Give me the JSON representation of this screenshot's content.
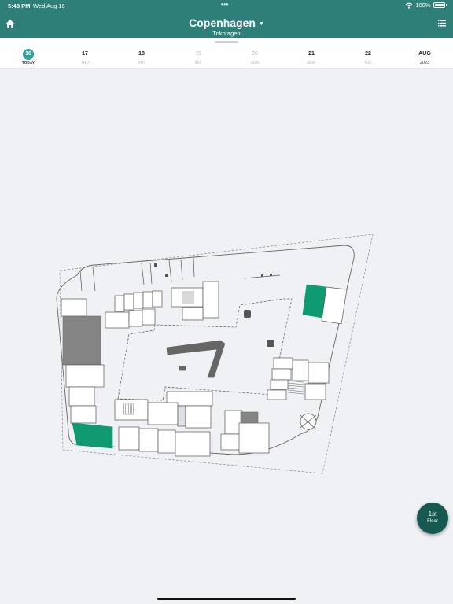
{
  "status_bar": {
    "time": "5:48 PM",
    "date": "Wed Aug 16",
    "dots": "•••",
    "battery": "100%"
  },
  "header": {
    "title": "Copenhagen",
    "subtitle": "Trikotagen",
    "home_icon": "home-icon",
    "menu_icon": "list-menu-icon"
  },
  "date_strip": {
    "days": [
      {
        "num": "16",
        "label": "TODAY"
      },
      {
        "num": "17",
        "label": "THU"
      },
      {
        "num": "18",
        "label": "FRI"
      },
      {
        "num": "19",
        "label": "SAT"
      },
      {
        "num": "20",
        "label": "SUN"
      },
      {
        "num": "21",
        "label": "MON"
      },
      {
        "num": "22",
        "label": "TUE"
      }
    ],
    "month": "AUG",
    "year": "2023"
  },
  "floor_button": {
    "number": "1st",
    "label": "Floor"
  },
  "colors": {
    "header": "#2f7f79",
    "accent": "#2fa198",
    "room_available": "#0f9a72",
    "room_occupied": "#848484",
    "floor_button": "#165950"
  }
}
